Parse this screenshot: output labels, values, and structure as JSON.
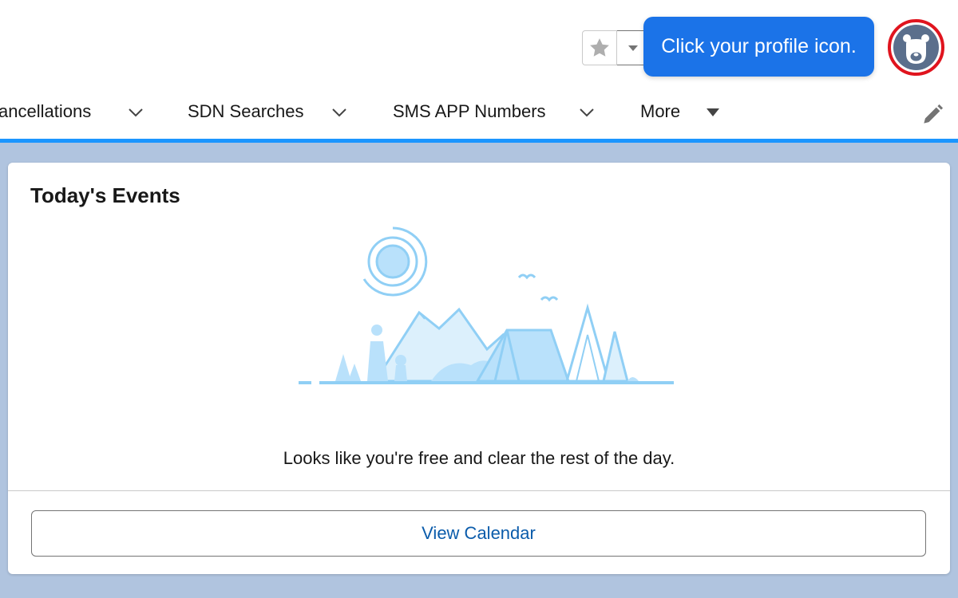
{
  "header": {
    "favorite_star_icon": "star-icon",
    "favorites_menu_icon": "caret-down-icon",
    "avatar_icon": "bear-avatar-icon"
  },
  "tooltip": {
    "text": "Click your profile icon."
  },
  "nav": {
    "items": [
      {
        "label": "ancellations",
        "icon": "chevron-down-icon"
      },
      {
        "label": "SDN Searches",
        "icon": "chevron-down-icon"
      },
      {
        "label": "SMS APP Numbers",
        "icon": "chevron-down-icon"
      },
      {
        "label": "More",
        "icon": "caret-down-icon"
      }
    ],
    "edit_icon": "pencil-icon"
  },
  "card": {
    "title": "Today's Events",
    "empty_message": "Looks like you're free and clear the rest of the day.",
    "button_label": "View Calendar",
    "illustration": "camping-scene-illustration"
  },
  "colors": {
    "tooltip_bg": "#1b73e8",
    "highlight_ring": "#e0141e",
    "nav_underline": "#1b96ff",
    "content_bg": "#b0c4df",
    "link_blue": "#0b5cab",
    "illustration_blue": "#90cff5"
  }
}
